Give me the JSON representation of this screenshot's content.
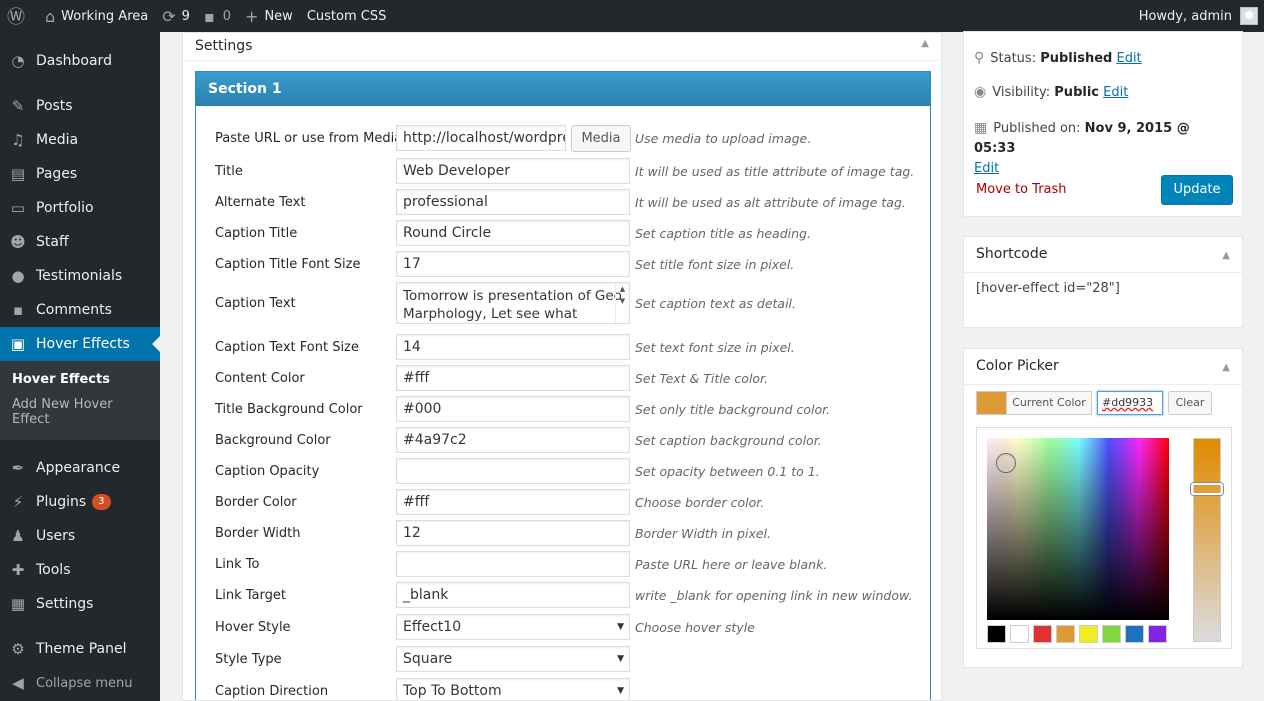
{
  "adminbar": {
    "site_name": "Working Area",
    "updates_count": "9",
    "comments_count": "0",
    "new_label": "New",
    "custom_css_label": "Custom CSS",
    "howdy": "Howdy, admin"
  },
  "menu": {
    "items": [
      {
        "label": "Dashboard",
        "icon": "dashboard-icon"
      },
      {
        "label": "Posts",
        "icon": "pin-icon"
      },
      {
        "label": "Media",
        "icon": "media-icon"
      },
      {
        "label": "Pages",
        "icon": "page-icon"
      },
      {
        "label": "Portfolio",
        "icon": "folder-icon"
      },
      {
        "label": "Staff",
        "icon": "staff-icon"
      },
      {
        "label": "Testimonials",
        "icon": "comment-icon"
      },
      {
        "label": "Comments",
        "icon": "comment-icon"
      },
      {
        "label": "Hover Effects",
        "icon": "image-icon"
      },
      {
        "label": "Appearance",
        "icon": "brush-icon"
      },
      {
        "label": "Plugins",
        "icon": "plug-icon",
        "badge": "3"
      },
      {
        "label": "Users",
        "icon": "user-icon"
      },
      {
        "label": "Tools",
        "icon": "wrench-icon"
      },
      {
        "label": "Settings",
        "icon": "settings-icon"
      },
      {
        "label": "Theme Panel",
        "icon": "gear-icon"
      }
    ],
    "submenu": [
      "Hover Effects",
      "Add New Hover Effect"
    ],
    "collapse": "Collapse menu"
  },
  "settings": {
    "title": "Settings",
    "section": "Section 1"
  },
  "media_button": "Media",
  "fields": [
    {
      "label": "Paste URL or use from Media",
      "value": "http://localhost/wordpre",
      "help": "Use media to upload image."
    },
    {
      "label": "Title",
      "value": "Web Developer",
      "help": "It will be used as title attribute of image tag."
    },
    {
      "label": "Alternate Text",
      "value": "professional",
      "help": "It will be used as alt attribute of image tag."
    },
    {
      "label": "Caption Title",
      "value": "Round Circle",
      "help": "Set caption title as heading."
    },
    {
      "label": "Caption Title Font Size",
      "value": "17",
      "help": "Set title font size in pixel."
    },
    {
      "label": "Caption Text",
      "value": "Tomorrow is presentation of Geo Marphology, Let see what",
      "help": "Set caption text as detail."
    },
    {
      "label": "Caption Text Font Size",
      "value": "14",
      "help": "Set text font size in pixel."
    },
    {
      "label": "Content Color",
      "value": "#fff",
      "help": "Set Text & Title color."
    },
    {
      "label": "Title Background Color",
      "value": "#000",
      "help": "Set only title background color."
    },
    {
      "label": "Background Color",
      "value": "#4a97c2",
      "help": "Set caption background color."
    },
    {
      "label": "Caption Opacity",
      "value": "",
      "help": "Set opacity between 0.1 to 1."
    },
    {
      "label": "Border Color",
      "value": "#fff",
      "help": "Choose border color."
    },
    {
      "label": "Border Width",
      "value": "12",
      "help": "Border Width in pixel."
    },
    {
      "label": "Link To",
      "value": "",
      "help": "Paste URL here or leave blank."
    },
    {
      "label": "Link Target",
      "value": "_blank",
      "help": "write _blank for opening link in new window."
    },
    {
      "label": "Hover Style",
      "value": "Effect10",
      "help": "Choose hover style"
    },
    {
      "label": "Style Type",
      "value": "Square",
      "help": ""
    },
    {
      "label": "Caption Direction",
      "value": "Top To Bottom",
      "help": ""
    }
  ],
  "publish": {
    "status_label": "Status:",
    "status": "Published",
    "visibility_label": "Visibility:",
    "visibility": "Public",
    "published_label": "Published on:",
    "published_date": "Nov 9, 2015 @ 05:33",
    "edit": "Edit",
    "trash": "Move to Trash",
    "update": "Update"
  },
  "shortcode": {
    "title": "Shortcode",
    "value": "[hover-effect id=\"28\"]"
  },
  "color_picker": {
    "title": "Color Picker",
    "current": "Current Color",
    "hex": "#dd9933",
    "clear": "Clear",
    "current_color": "#dd9933",
    "palette": [
      "#000000",
      "#ffffff",
      "#dd3333",
      "#dd9933",
      "#eeee22",
      "#81d742",
      "#1e73be",
      "#8224e3"
    ]
  }
}
